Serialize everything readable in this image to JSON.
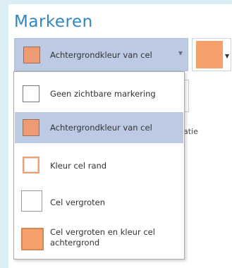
{
  "title": "Markeren",
  "combo": {
    "selected_label": "Achtergrondkleur van cel",
    "swatch_color": "#ee9a72"
  },
  "color_picker": {
    "color": "#f6a06c"
  },
  "background_text": "atie",
  "dropdown": {
    "items": [
      {
        "label": "Geen zichtbare markering",
        "icon": "empty-box-icon"
      },
      {
        "label": "Achtergrondkleur van cel",
        "icon": "filled-orange-box-icon",
        "selected": true
      },
      {
        "label": "Kleur cel rand",
        "icon": "orange-border-box-icon"
      },
      {
        "label": "Cel vergroten",
        "icon": "large-empty-box-icon"
      },
      {
        "label": "Cel vergroten en kleur cel achtergrond",
        "icon": "large-filled-orange-box-icon"
      }
    ]
  }
}
